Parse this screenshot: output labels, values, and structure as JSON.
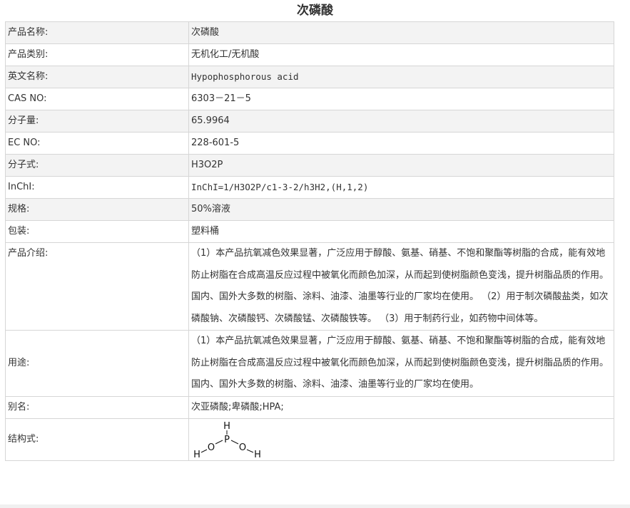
{
  "title": "次磷酸",
  "rows": {
    "product_name": {
      "label": "产品名称:",
      "value": "次磷酸"
    },
    "category": {
      "label": "产品类别:",
      "value": "无机化工/无机酸"
    },
    "english_name": {
      "label": "英文名称:",
      "value": "Hypophosphorous acid"
    },
    "cas": {
      "label": "CAS NO:",
      "value": "6303－21－5"
    },
    "mol_weight": {
      "label": "分子量:",
      "value": "65.9964"
    },
    "ec": {
      "label": "EC NO:",
      "value": "228-601-5"
    },
    "formula": {
      "label": "分子式:",
      "value": "H3O2P"
    },
    "inchi": {
      "label": "InChI:",
      "value": "InChI=1/H3O2P/c1-3-2/h3H2,(H,1,2)"
    },
    "spec": {
      "label": "规格:",
      "value": "50%溶液"
    },
    "packaging": {
      "label": "包装:",
      "value": "塑料桶"
    },
    "intro": {
      "label": "产品介绍:",
      "value": "（1）本产品抗氧减色效果显著，广泛应用于醇酸、氨基、硝基、不饱和聚酯等树脂的合成，能有效地防止树脂在合成高温反应过程中被氧化而颜色加深，从而起到使树脂颜色变浅，提升树脂品质的作用。国内、国外大多数的树脂、涂料、油漆、油墨等行业的厂家均在使用。        （2）用于制次磷酸盐类，如次磷酸钠、次磷酸钙、次磷酸锰、次磷酸铁等。       （3）用于制药行业，如药物中间体等。"
    },
    "usage": {
      "label": "用途:",
      "value": "（1）本产品抗氧减色效果显著，广泛应用于醇酸、氨基、硝基、不饱和聚酯等树脂的合成，能有效地防止树脂在合成高温反应过程中被氧化而颜色加深，从而起到使树脂颜色变浅，提升树脂品质的作用。国内、国外大多数的树脂、涂料、油漆、油墨等行业的厂家均在使用。"
    },
    "alias": {
      "label": "别名:",
      "value": "次亚磷酸;卑磷酸;HPA;"
    },
    "structure": {
      "label": "结构式:",
      "atoms": {
        "h_top": "H",
        "p": "P",
        "o_left": "O",
        "o_right": "O",
        "h_left": "H",
        "h_right": "H"
      }
    }
  }
}
